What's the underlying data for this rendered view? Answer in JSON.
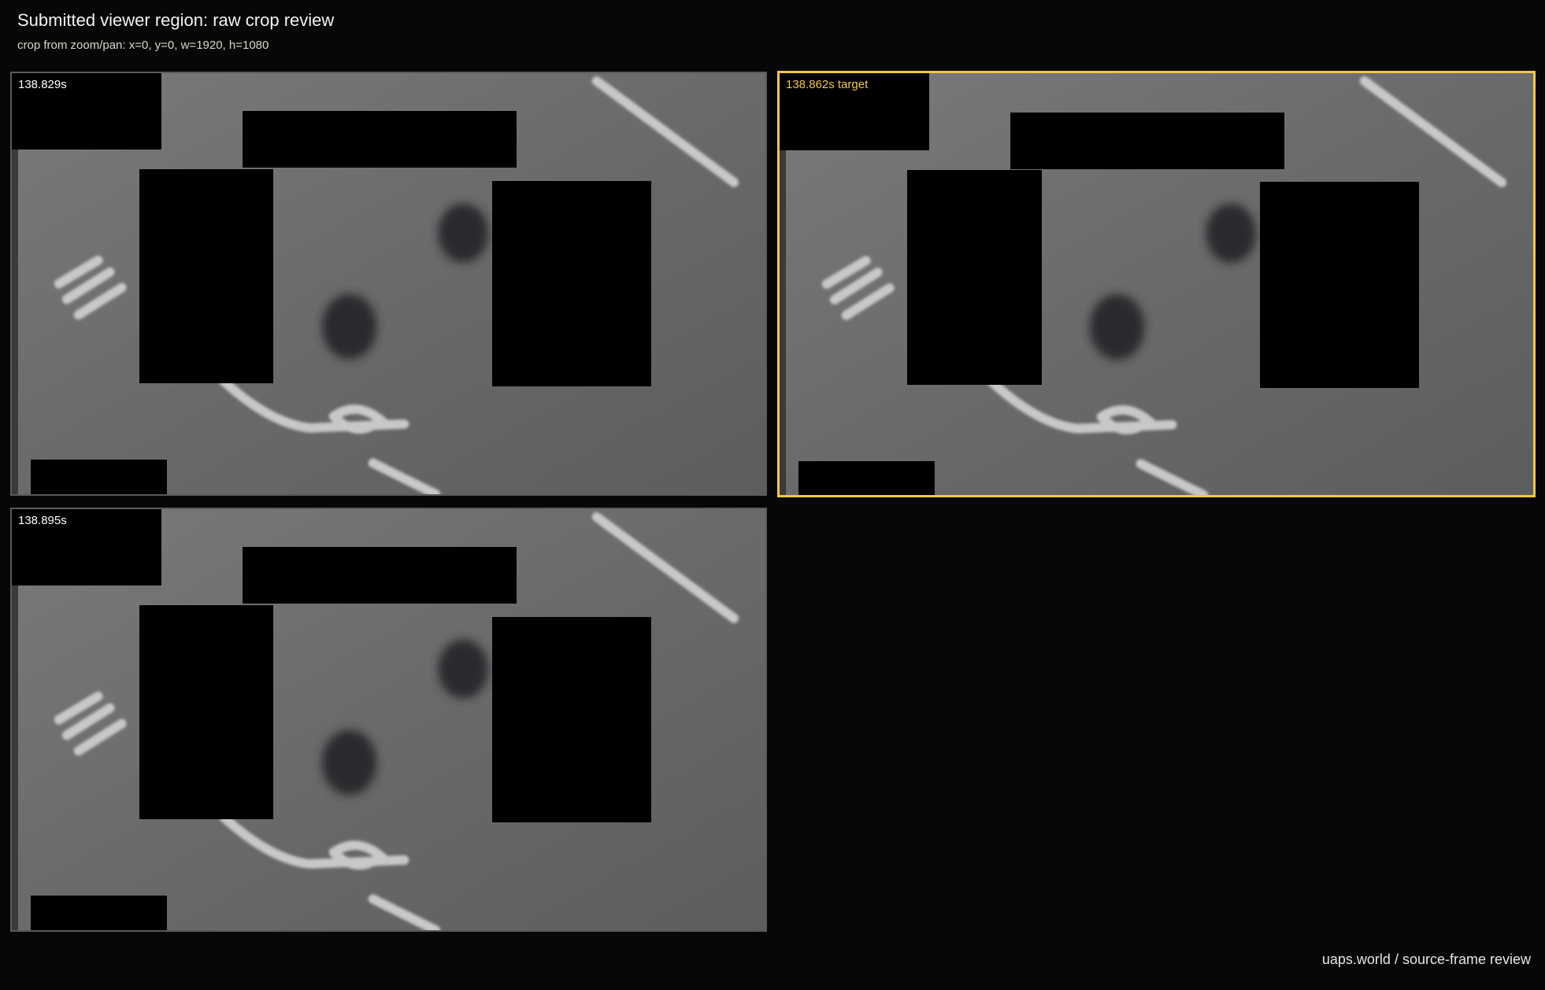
{
  "page": {
    "title": "Submitted viewer region: raw crop review",
    "subtitle": "crop from zoom/pan: x=0, y=0, w=1920, h=1080",
    "footer": "uaps.world / source-frame review"
  },
  "frames": [
    {
      "label": "138.829s",
      "is_target": false
    },
    {
      "label": "138.862s target",
      "is_target": true
    },
    {
      "label": "138.895s",
      "is_target": false
    }
  ],
  "colors": {
    "background": "#070707",
    "target_outline": "#f0c84a",
    "label_text": "#ffffff",
    "subtitle_text": "#d9d5c8"
  }
}
